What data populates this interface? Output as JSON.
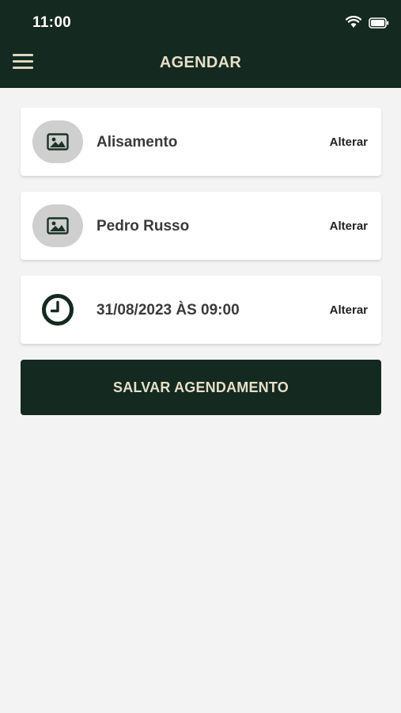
{
  "status_bar": {
    "time": "11:00",
    "wifi_icon": "wifi-icon",
    "battery_icon": "battery-icon"
  },
  "header": {
    "title": "AGENDAR",
    "menu_icon": "hamburger-menu-icon",
    "background": "#14291f",
    "title_color": "#e6dfc9"
  },
  "cards": [
    {
      "label": "Alisamento",
      "icon": "image-placeholder-icon",
      "action": "Alterar"
    },
    {
      "label": "Pedro Russo",
      "icon": "image-placeholder-icon",
      "action": "Alterar"
    },
    {
      "label": "31/08/2023 ÀS 09:00",
      "icon": "clock-icon",
      "action": "Alterar"
    }
  ],
  "save_button": {
    "label": "SALVAR AGENDAMENTO",
    "background": "#14291f"
  },
  "page_background": "#f3f3f3"
}
